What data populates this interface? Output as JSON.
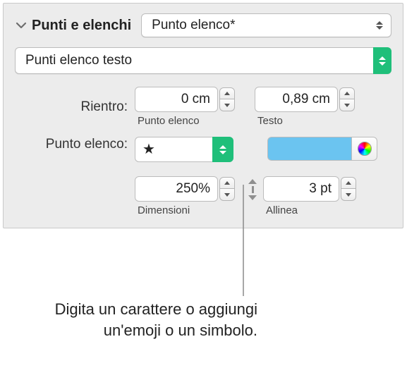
{
  "section_title": "Punti e elenchi",
  "style_selected": "Punto elenco*",
  "bullet_type_selected": "Punti elenco testo",
  "indent": {
    "label": "Rientro:",
    "bullet": {
      "value": "0 cm",
      "sublabel": "Punto elenco"
    },
    "text": {
      "value": "0,89 cm",
      "sublabel": "Testo"
    }
  },
  "bullet": {
    "label": "Punto elenco:",
    "glyph": "★",
    "color": "#6bc4f0"
  },
  "size": {
    "value": "250%",
    "sublabel": "Dimensioni"
  },
  "align": {
    "value": "3 pt",
    "sublabel": "Allinea"
  },
  "caption": "Digita un carattere o aggiungi un'emoji o un simbolo."
}
